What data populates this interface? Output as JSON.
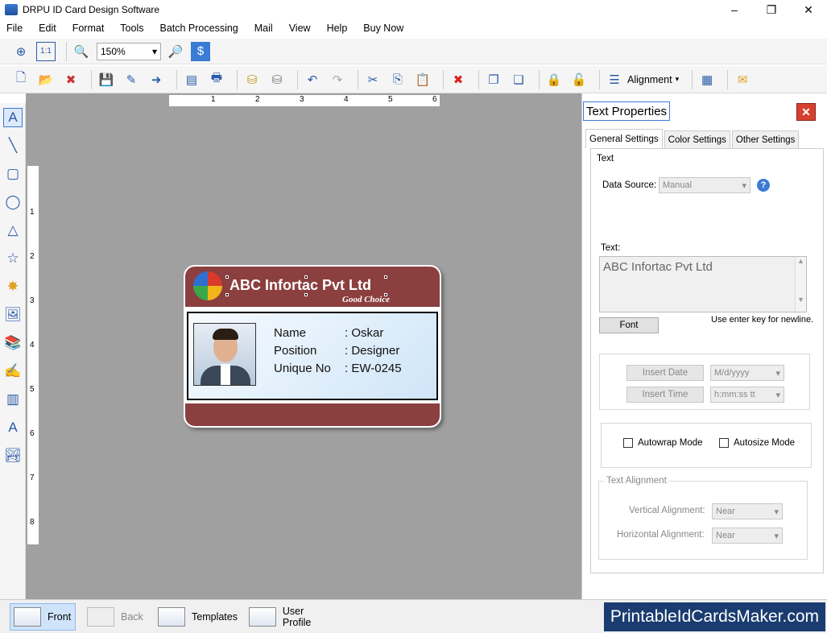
{
  "window": {
    "title": "DRPU ID Card Design Software",
    "controls": [
      "–",
      "❐",
      "✕"
    ]
  },
  "menu": [
    "File",
    "Edit",
    "Format",
    "Tools",
    "Batch Processing",
    "Mail",
    "View",
    "Help",
    "Buy Now"
  ],
  "toolbar": {
    "zoom_value": "150%",
    "alignment_label": "Alignment"
  },
  "ruler": {
    "horizontal": [
      "1",
      "2",
      "3",
      "4",
      "5",
      "6"
    ],
    "vertical": [
      "1",
      "2",
      "3",
      "4",
      "5",
      "6",
      "7",
      "8"
    ]
  },
  "card": {
    "company": "ABC Infortac Pvt Ltd",
    "tagline": "Good Choice",
    "fields": [
      {
        "label": "Name",
        "value": ": Oskar"
      },
      {
        "label": "Position",
        "value": ": Designer"
      },
      {
        "label": "Unique No",
        "value": ": EW-0245"
      }
    ],
    "header_color": "#8b3f3f"
  },
  "panel": {
    "title": "Text Properties",
    "tabs": [
      "General Settings",
      "Color Settings",
      "Other Settings"
    ],
    "text_group_label": "Text",
    "data_source_label": "Data Source:",
    "data_source_value": "Manual",
    "text_label": "Text:",
    "text_value": "ABC Infortac Pvt Ltd",
    "font_button": "Font",
    "newline_hint": "Use enter key for newline.",
    "insert_date_button": "Insert Date",
    "date_format": "M/d/yyyy",
    "insert_time_button": "Insert Time",
    "time_format": "h:mm:ss tt",
    "autowrap_label": "Autowrap Mode",
    "autosize_label": "Autosize Mode",
    "alignment_group_label": "Text Alignment",
    "vertical_label": "Vertical Alignment:",
    "vertical_value": "Near",
    "horizontal_label": "Horizontal  Alignment:",
    "horizontal_value": "Near"
  },
  "bottom": {
    "front": "Front",
    "back": "Back",
    "templates": "Templates",
    "user_profile": "User Profile",
    "brand": "PrintableIdCardsMaker.com"
  }
}
